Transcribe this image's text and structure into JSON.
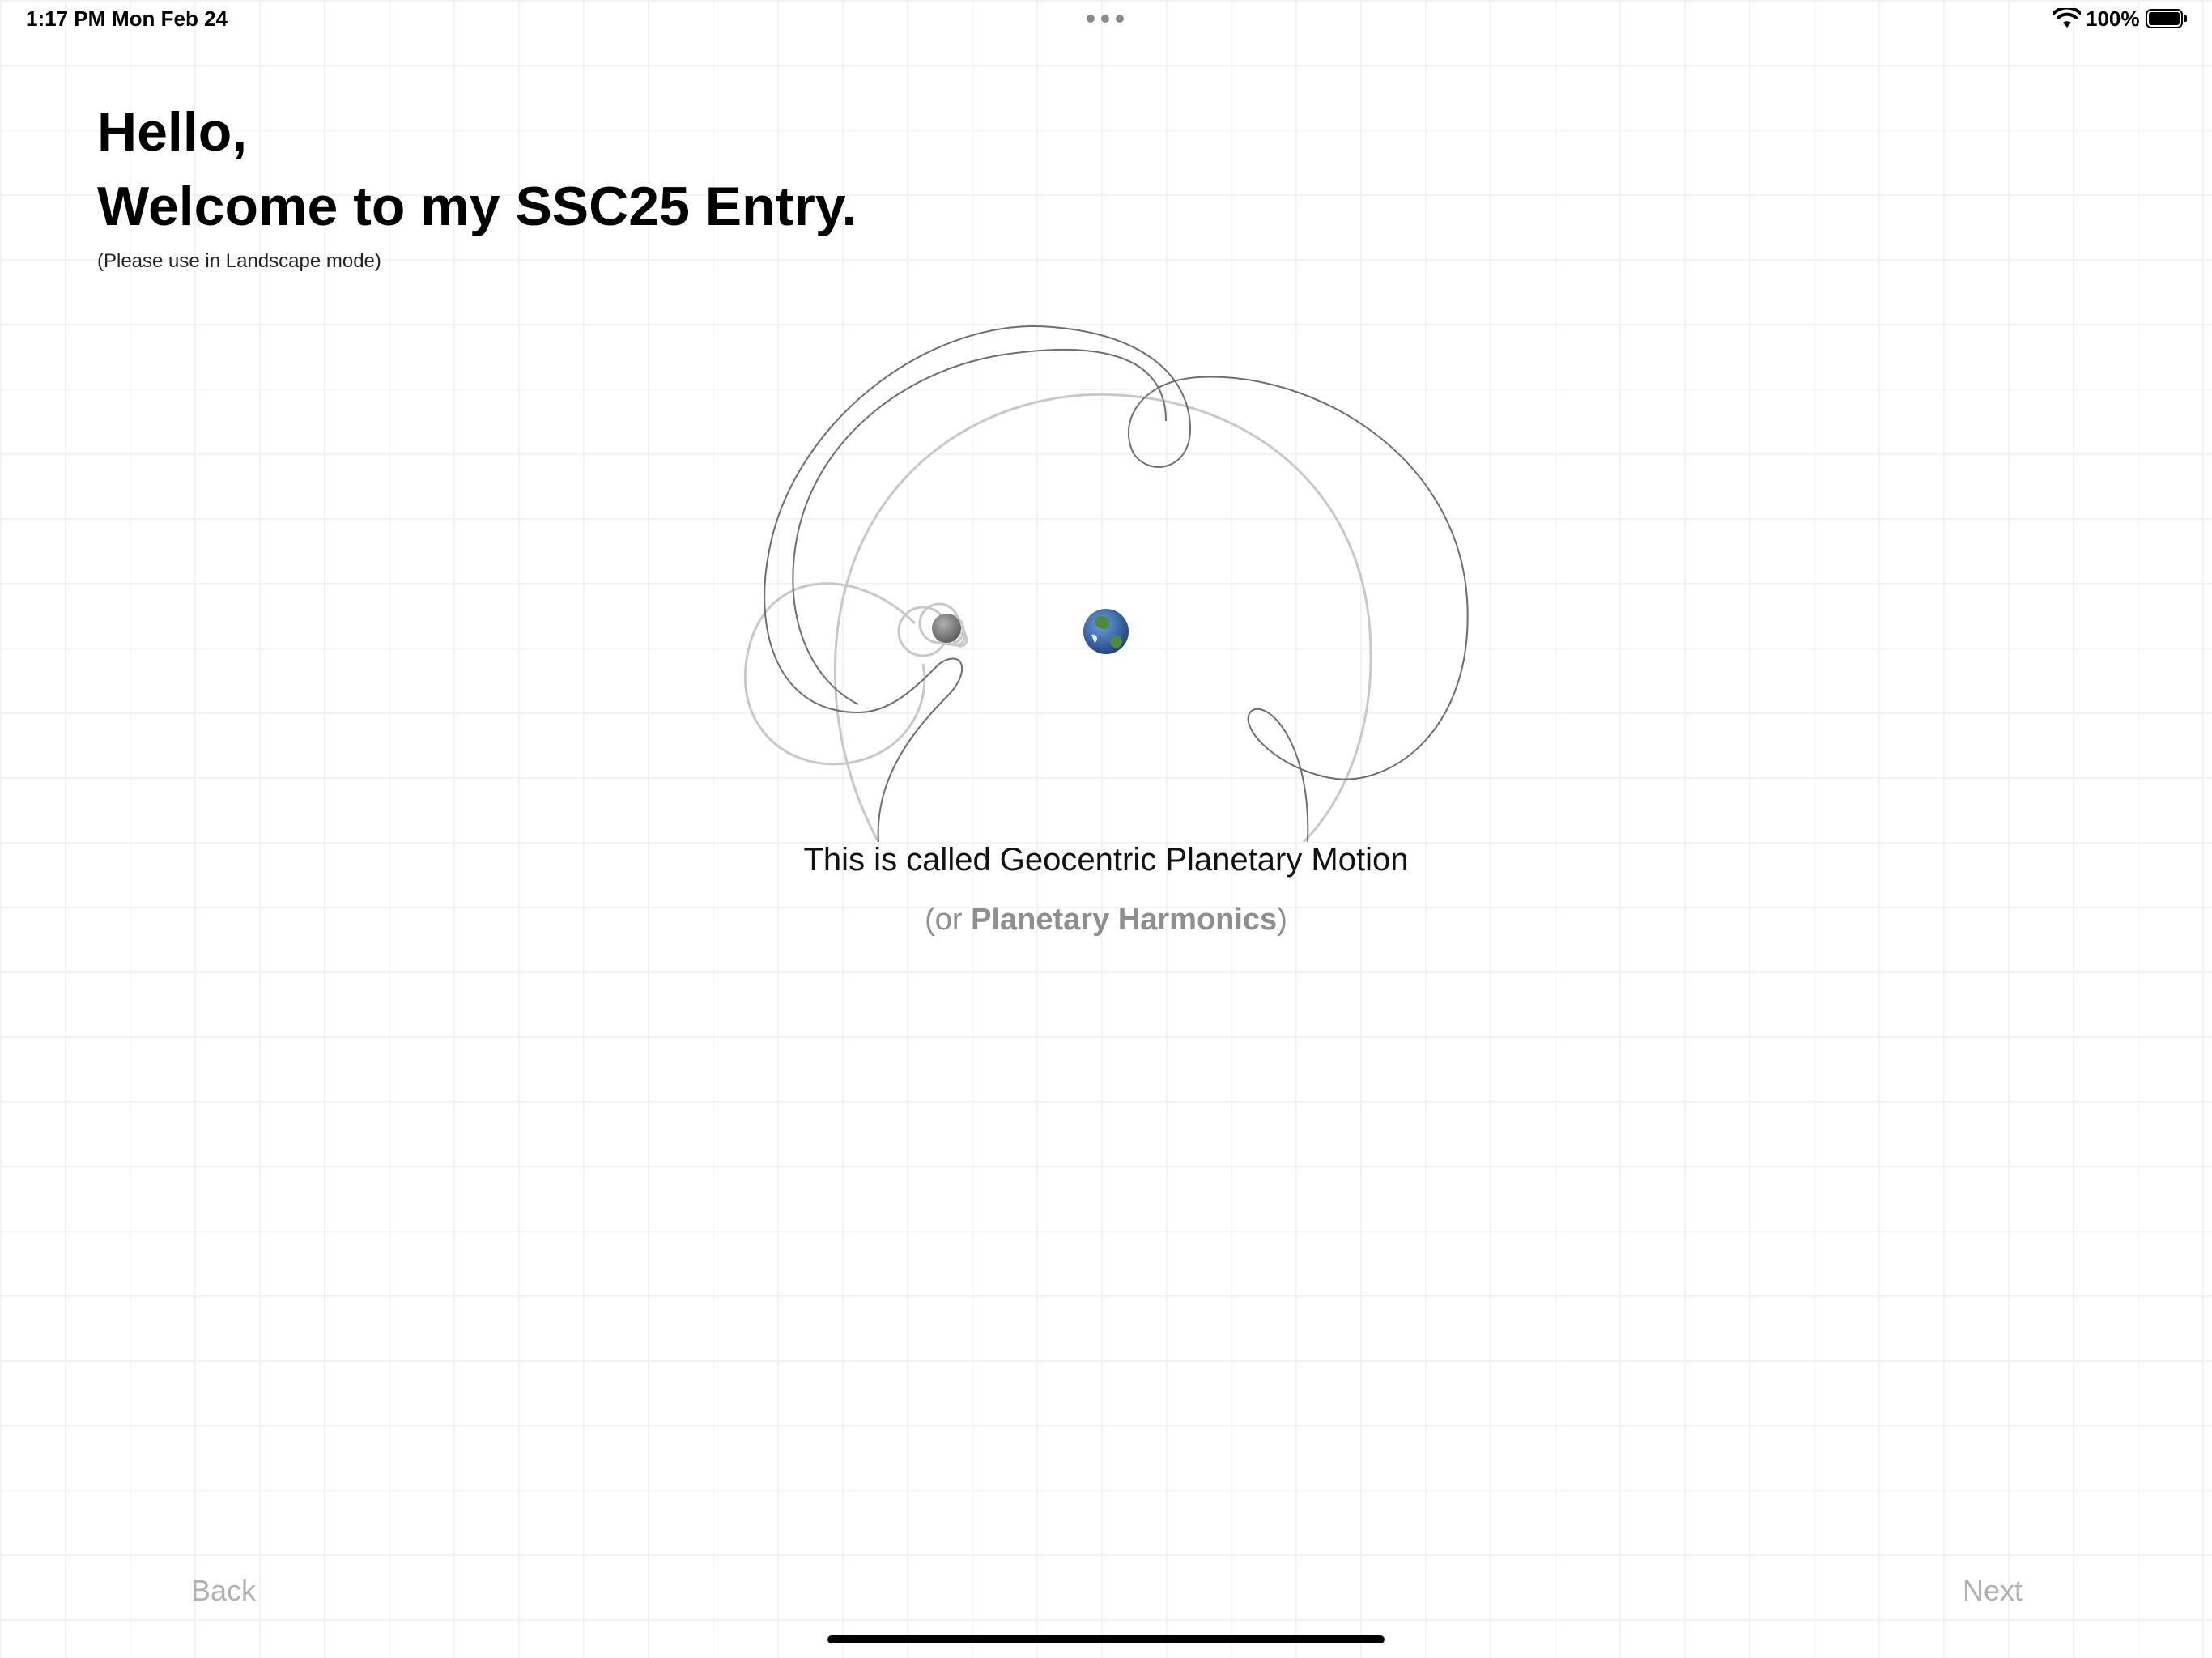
{
  "status_bar": {
    "time": "1:17 PM",
    "date": "Mon Feb 24",
    "battery_percent": "100%",
    "battery_level": 1.0,
    "wifi_icon": "wifi-icon",
    "battery_icon": "battery-icon"
  },
  "header": {
    "greeting": "Hello,",
    "welcome": "Welcome to my SSC25 Entry.",
    "hint": "(Please use in Landscape mode)"
  },
  "visualization": {
    "center_body_icon": "earth-icon",
    "orbiting_body_icon": "moon-icon",
    "colors": {
      "dark_trail": "#6e6e6e",
      "light_trail": "#c8c8c8",
      "moon": "#7a7a7a",
      "earth_ocean": "#2b5fa8",
      "earth_land": "#4f8a3a"
    }
  },
  "caption": {
    "main": "This is called Geocentric Planetary Motion",
    "sub_open": "(or ",
    "sub_strong": "Planetary Harmonics",
    "sub_close": ")"
  },
  "nav": {
    "back_label": "Back",
    "next_label": "Next"
  },
  "theme": {
    "background": "#ffffff",
    "grid": "#f3f3f3",
    "nav_disabled": "#b0b0b5",
    "secondary_text": "#8e8e93"
  }
}
